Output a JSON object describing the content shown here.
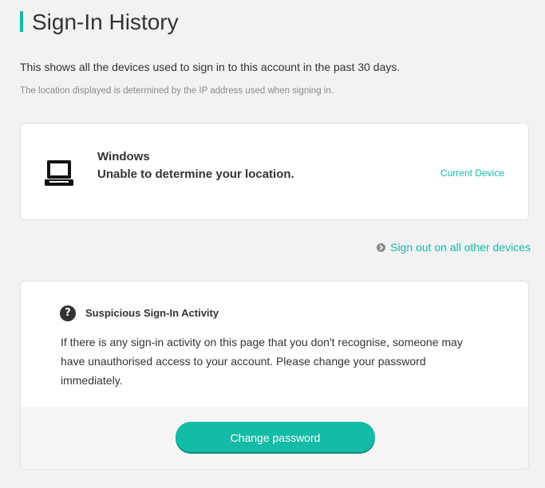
{
  "header": {
    "title": "Sign-In History",
    "accent_color": "#17b9a6"
  },
  "intro": {
    "text": "This shows all the devices used to sign in to this account in the past 30 days.",
    "note": "The location displayed is determined by the IP address used when signing in."
  },
  "devices": [
    {
      "icon": "laptop-icon",
      "name": "Windows",
      "location": "Unable to determine your location.",
      "status": "Current Device"
    }
  ],
  "signout": {
    "icon": "chevron-right-icon",
    "label": "Sign out on all other devices"
  },
  "suspicious": {
    "icon": "question-icon",
    "icon_glyph": "?",
    "title": "Suspicious Sign-In Activity",
    "body": "If there is any sign-in activity on this page that you don't recognise, someone may have unauthorised access to your account. Please change your password immediately.",
    "button_label": "Change password",
    "button_color": "#14bba6"
  }
}
